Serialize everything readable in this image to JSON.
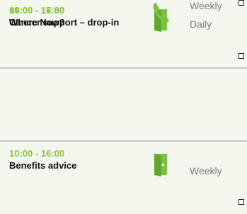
{
  "colors": {
    "background": "#f3f7ee",
    "accent_green": "#8cc63f",
    "icon_green": "#7cc242",
    "title_text": "#111111",
    "frequency_text": "#7d7d7d",
    "divider": "#c7c7c7"
  },
  "sessions": [
    {
      "time": "09:00 - 17:00",
      "title": "Cancer support – drop-in",
      "icon": "door-icon",
      "frequency": "Daily"
    },
    {
      "time": "10:00 - 16:00",
      "title": "Benefits advice",
      "icon": "door-icon",
      "frequency": "Weekly"
    },
    {
      "time": "14:00 - 16:30",
      "title": "Where Now?",
      "icon": "phone-icon",
      "frequency": "Weekly"
    }
  ]
}
